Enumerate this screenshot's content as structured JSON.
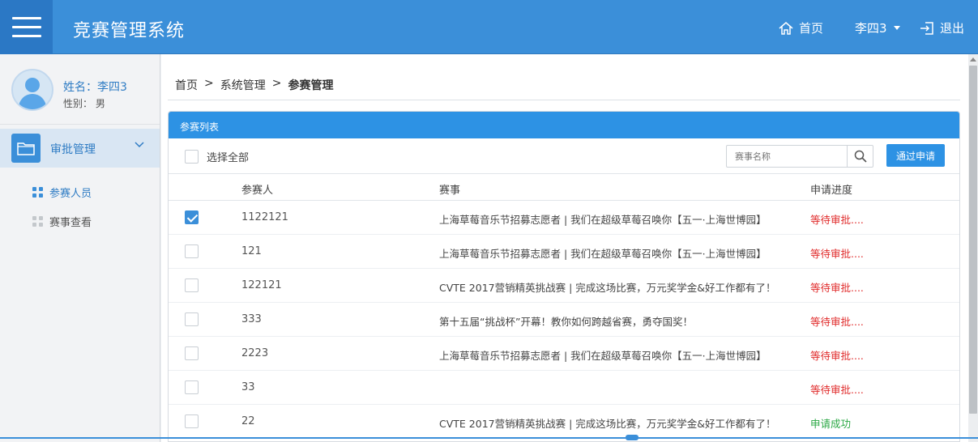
{
  "header": {
    "title": "竞赛管理系统",
    "home_label": "首页",
    "user_label": "李四3",
    "logout_label": "退出"
  },
  "profile": {
    "name_line": "姓名：李四3",
    "gender_line": "性别： 男"
  },
  "sidebar": {
    "group_label": "审批管理",
    "items": [
      {
        "label": "参赛人员",
        "active": true
      },
      {
        "label": "赛事查看",
        "active": false
      }
    ]
  },
  "breadcrumb": {
    "home": "首页",
    "sep": ">",
    "level2": "系统管理",
    "current": "参赛管理"
  },
  "panel": {
    "title": "参赛列表",
    "select_all_label": "选择全部",
    "search_placeholder": "赛事名称",
    "approve_label": "通过申请",
    "columns": {
      "person": "参赛人",
      "event": "赛事",
      "status": "申请进度"
    },
    "rows": [
      {
        "person": "1122121",
        "event": "上海草莓音乐节招募志愿者 | 我们在超级草莓召唤你【五一·上海世博园】",
        "status": "等待审批....",
        "state": "wait",
        "checked": true
      },
      {
        "person": "121",
        "event": "上海草莓音乐节招募志愿者 | 我们在超级草莓召唤你【五一·上海世博园】",
        "status": "等待审批....",
        "state": "wait",
        "checked": false
      },
      {
        "person": "122121",
        "event": "CVTE 2017营销精英挑战赛 | 完成这场比赛，万元奖学金&好工作都有了！",
        "status": "等待审批....",
        "state": "wait",
        "checked": false
      },
      {
        "person": "333",
        "event": "第十五届“挑战杯”开幕！教你如何跨越省赛，勇夺国奖！",
        "status": "等待审批....",
        "state": "wait",
        "checked": false
      },
      {
        "person": "2223",
        "event": "上海草莓音乐节招募志愿者 | 我们在超级草莓召唤你【五一·上海世博园】",
        "status": "等待审批....",
        "state": "wait",
        "checked": false
      },
      {
        "person": "33",
        "event": "",
        "status": "等待审批....",
        "state": "wait",
        "checked": false
      },
      {
        "person": "22",
        "event": "CVTE 2017营销精英挑战赛 | 完成这场比赛，万元奖学金&好工作都有了！",
        "status": "申请成功",
        "state": "ok",
        "checked": false
      }
    ]
  },
  "colors": {
    "header_bg": "#3b8fd9",
    "menu_box_bg": "#2b78c5",
    "panel_head_bg": "#2d92e4",
    "status_wait": "#e02b2b",
    "status_ok": "#2aa844"
  },
  "icons": {
    "menu": "hamburger-icon",
    "home": "home-icon",
    "logout": "logout-icon",
    "folder": "folder-icon",
    "search": "search-icon"
  }
}
